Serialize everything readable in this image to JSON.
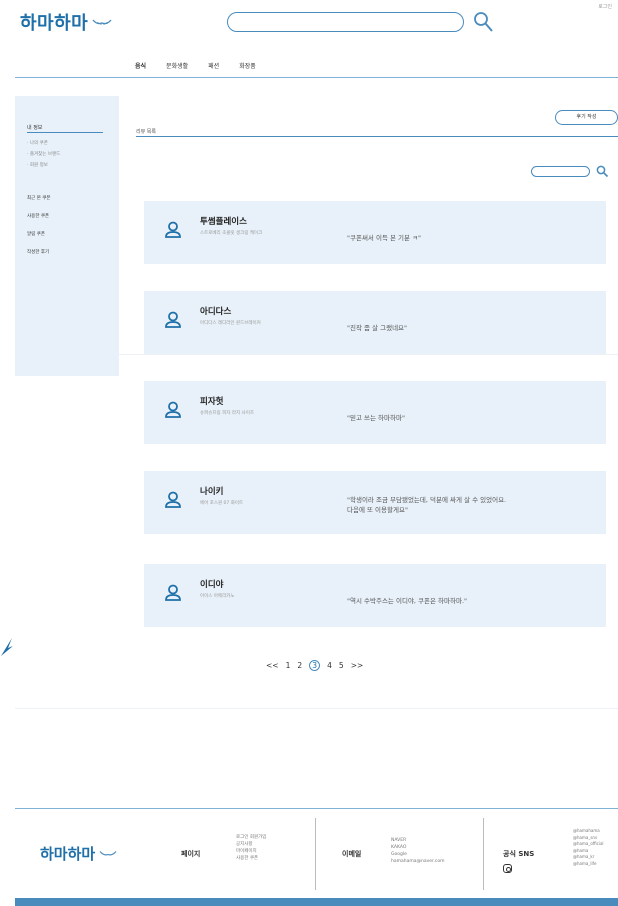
{
  "header": {
    "top_link": "로그인",
    "logo": "하마하마",
    "search_placeholder": ""
  },
  "nav": {
    "items": [
      "음식",
      "문화생활",
      "패션",
      "화장품"
    ]
  },
  "sidebar": {
    "title": "내 정보",
    "sub_items": [
      "· 나의 쿠폰",
      "· 즐겨찾는 브랜드",
      "· 회원 정보"
    ],
    "menu": [
      "최근 본 쿠폰",
      "사용한 쿠폰",
      "알림 쿠폰",
      "작성한 후기"
    ]
  },
  "section": {
    "label": "리뷰 목록",
    "write_button": "후기 작성"
  },
  "cards": [
    {
      "brand": "투썸플레이스",
      "sub": "스트로베리 초콜릿 생크림 케이크",
      "review": [
        "\"쿠폰써서 이득 본 기분 ㅋ\""
      ]
    },
    {
      "brand": "아디다스",
      "sub": "아디다스 레디라인 윈드브레이커",
      "review": [
        "\"진작 좀 살 그랬네요\""
      ]
    },
    {
      "brand": "피자헛",
      "sub": "슈퍼슈프림 피자 라지 사이즈",
      "review": [
        "\"믿고 쓰는 하마하마\""
      ]
    },
    {
      "brand": "나이키",
      "sub": "에어 포스원 07 화이트",
      "review": [
        "\"학생이라 조금 부담됐었는데, 덕분에 싸게 살 수 있었어요.",
        "다음에 또 이용할게요\""
      ]
    },
    {
      "brand": "이디야",
      "sub": "아이스 아메리카노",
      "review": [
        "\"역시 수박주스는 이디야, 쿠폰은 하마하마.\""
      ]
    }
  ],
  "pagination": {
    "prev": "<<",
    "pages": [
      "1",
      "2",
      "3",
      "4",
      "5"
    ],
    "current": "3",
    "next": ">>"
  },
  "footer": {
    "logo": "하마하마",
    "pages_title": "페이지",
    "pages_list": [
      "로그인 회원가입",
      "공지사항",
      "마이페이지",
      "사용한 쿠폰"
    ],
    "email_title": "이메일",
    "email_list": [
      "NAVER",
      "KAKAO",
      "Google",
      "hamahama@naver.com"
    ],
    "sns_title": "공식 SNS",
    "sns_list": [
      "@hamahama",
      "@hama_sns",
      "@hama_official",
      "@hama",
      "@hama_kr",
      "@hama_life"
    ]
  },
  "colors": {
    "accent": "#4a8bbd",
    "logo": "#1f6fa8",
    "card_bg": "#e8f1f9"
  }
}
